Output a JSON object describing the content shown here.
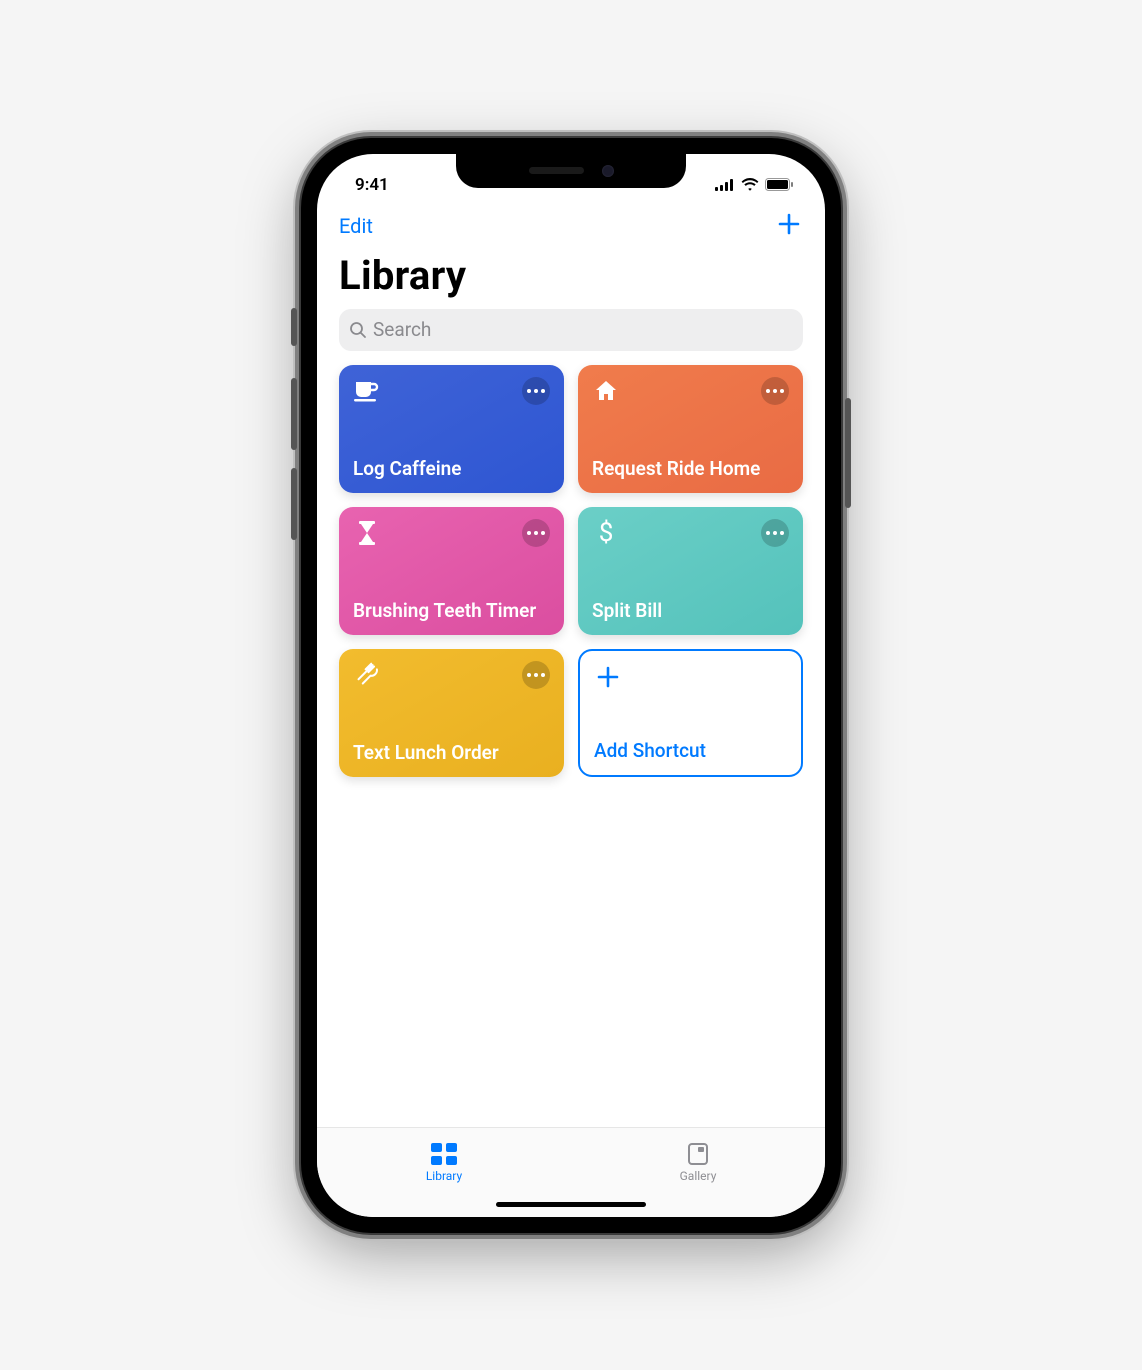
{
  "status": {
    "time": "9:41"
  },
  "nav": {
    "edit": "Edit"
  },
  "title": "Library",
  "search": {
    "placeholder": "Search"
  },
  "shortcuts": [
    {
      "label": "Log Caffeine",
      "icon": "cup",
      "color": "blue"
    },
    {
      "label": "Request Ride Home",
      "icon": "home",
      "color": "orange"
    },
    {
      "label": "Brushing Teeth Timer",
      "icon": "hourglass",
      "color": "pink"
    },
    {
      "label": "Split Bill",
      "icon": "dollar",
      "color": "teal"
    },
    {
      "label": "Text Lunch Order",
      "icon": "utensils",
      "color": "yellow"
    }
  ],
  "add_shortcut": {
    "label": "Add Shortcut"
  },
  "tabs": {
    "library": "Library",
    "gallery": "Gallery"
  },
  "colors": {
    "accent": "#007aff"
  }
}
